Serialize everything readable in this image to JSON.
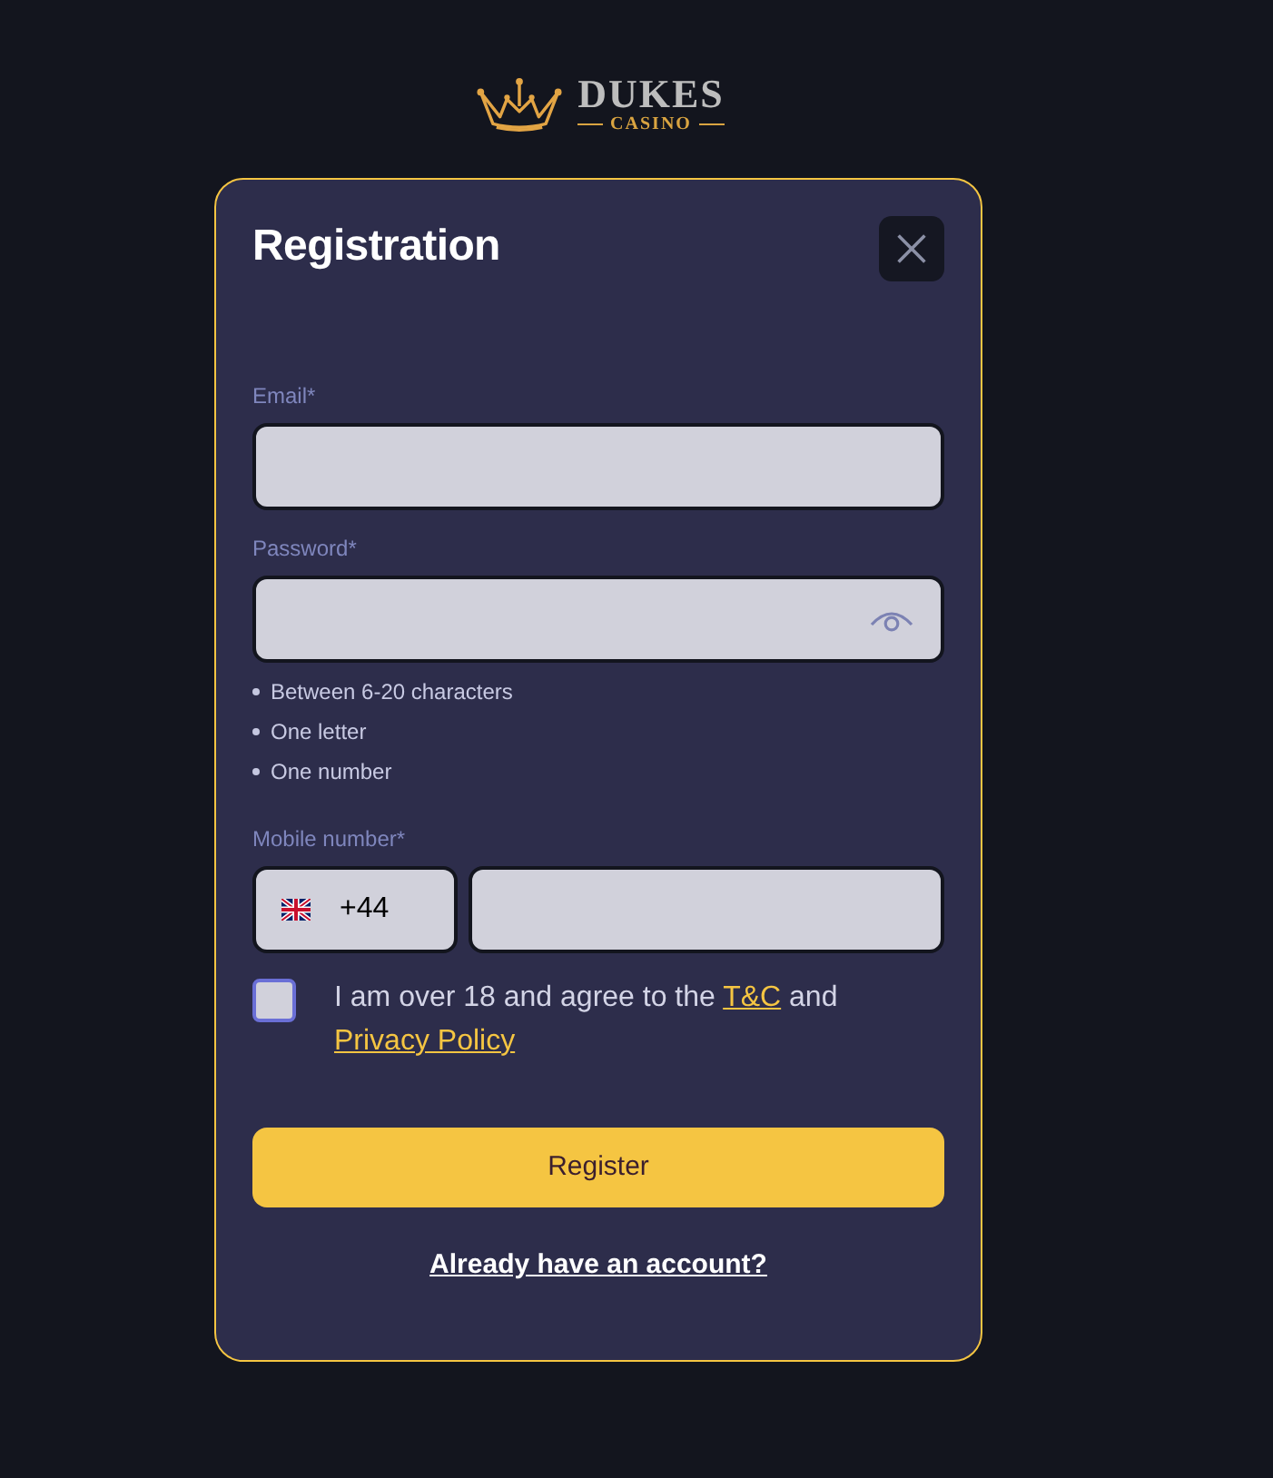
{
  "logo": {
    "name": "DUKES",
    "tagline": "CASINO"
  },
  "dialog": {
    "title": "Registration"
  },
  "fields": [
    {
      "kind": "email",
      "label": "Email*"
    },
    {
      "kind": "password",
      "label": "Password*",
      "rules": [
        "Between 6-20 characters",
        "One letter",
        "One number"
      ]
    },
    {
      "kind": "phone",
      "label": "Mobile number*",
      "country_code": "+44"
    }
  ],
  "consent": {
    "checked": false,
    "parts": [
      {
        "kind": "text",
        "text": "I am over 18 and agree to the "
      },
      {
        "kind": "link",
        "text": "T&C"
      },
      {
        "kind": "text",
        "text": " and "
      },
      {
        "kind": "link",
        "text": "Privacy Policy"
      }
    ]
  },
  "register_button": {
    "label": "Register"
  },
  "login_link": {
    "label": "Already have an account?"
  }
}
